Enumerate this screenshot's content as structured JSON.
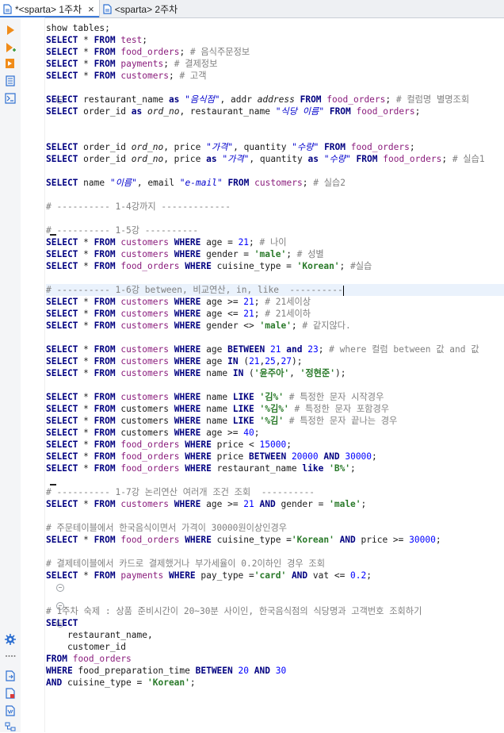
{
  "tabs": [
    {
      "label": "*<sparta> 1주차",
      "close": "×",
      "active": true
    },
    {
      "label": "<sparta> 2주차",
      "close": "",
      "active": false
    }
  ],
  "colors": {
    "keyword": "#000080",
    "table": "#8a1c7c",
    "string": "#0000cc",
    "literal": "#2a7a2a",
    "number": "#0000ff",
    "comment": "#808080"
  },
  "lines": [
    [
      [
        "t",
        "show tables;"
      ]
    ],
    [
      [
        "k",
        "SELECT"
      ],
      [
        "t",
        " * "
      ],
      [
        "k",
        "FROM"
      ],
      [
        "t",
        " "
      ],
      [
        "b",
        "test"
      ],
      [
        "t",
        ";"
      ]
    ],
    [
      [
        "k",
        "SELECT"
      ],
      [
        "t",
        " * "
      ],
      [
        "k",
        "FROM"
      ],
      [
        "t",
        " "
      ],
      [
        "b",
        "food_orders"
      ],
      [
        "t",
        "; "
      ],
      [
        "c",
        "# 음식주문정보"
      ]
    ],
    [
      [
        "k",
        "SELECT"
      ],
      [
        "t",
        " * "
      ],
      [
        "k",
        "FROM"
      ],
      [
        "t",
        " "
      ],
      [
        "b",
        "payments"
      ],
      [
        "t",
        "; "
      ],
      [
        "c",
        "# 결제정보"
      ]
    ],
    [
      [
        "k",
        "SELECT"
      ],
      [
        "t",
        " * "
      ],
      [
        "k",
        "FROM"
      ],
      [
        "t",
        " "
      ],
      [
        "b",
        "customers"
      ],
      [
        "t",
        "; "
      ],
      [
        "c",
        "# 고객"
      ]
    ],
    [],
    [
      [
        "k",
        "SELECT"
      ],
      [
        "t",
        " restaurant_name "
      ],
      [
        "k",
        "as"
      ],
      [
        "t",
        " "
      ],
      [
        "s",
        "\"음식점\""
      ],
      [
        "t",
        ", addr "
      ],
      [
        "i",
        "address"
      ],
      [
        "t",
        " "
      ],
      [
        "k",
        "FROM"
      ],
      [
        "t",
        " "
      ],
      [
        "b",
        "food_orders"
      ],
      [
        "t",
        "; "
      ],
      [
        "c",
        "# 컬럼명 별명조회"
      ]
    ],
    [
      [
        "k",
        "SELECT"
      ],
      [
        "t",
        " order_id "
      ],
      [
        "k",
        "as"
      ],
      [
        "t",
        " "
      ],
      [
        "i",
        "ord_no"
      ],
      [
        "t",
        ", restaurant_name "
      ],
      [
        "s",
        "\"식당 이름\""
      ],
      [
        "t",
        " "
      ],
      [
        "k",
        "FROM"
      ],
      [
        "t",
        " "
      ],
      [
        "b",
        "food_orders"
      ],
      [
        "t",
        ";"
      ]
    ],
    [],
    [],
    [
      [
        "k",
        "SELECT"
      ],
      [
        "t",
        " order_id "
      ],
      [
        "i",
        "ord_no"
      ],
      [
        "t",
        ", price "
      ],
      [
        "s",
        "\"가격\""
      ],
      [
        "t",
        ", quantity "
      ],
      [
        "s",
        "\"수량\""
      ],
      [
        "t",
        " "
      ],
      [
        "k",
        "FROM"
      ],
      [
        "t",
        " "
      ],
      [
        "b",
        "food_orders"
      ],
      [
        "t",
        ";"
      ]
    ],
    [
      [
        "k",
        "SELECT"
      ],
      [
        "t",
        " order_id "
      ],
      [
        "i",
        "ord_no"
      ],
      [
        "t",
        ", price "
      ],
      [
        "k",
        "as"
      ],
      [
        "t",
        " "
      ],
      [
        "s",
        "\"가격\""
      ],
      [
        "t",
        ", quantity "
      ],
      [
        "k",
        "as"
      ],
      [
        "t",
        " "
      ],
      [
        "s",
        "\"수량\""
      ],
      [
        "t",
        " "
      ],
      [
        "k",
        "FROM"
      ],
      [
        "t",
        " "
      ],
      [
        "b",
        "food_orders"
      ],
      [
        "t",
        "; "
      ],
      [
        "c",
        "# 실습1"
      ]
    ],
    [],
    [
      [
        "k",
        "SELECT"
      ],
      [
        "t",
        " name "
      ],
      [
        "s",
        "\"이름\""
      ],
      [
        "t",
        ", email "
      ],
      [
        "s",
        "\"e-mail\""
      ],
      [
        "t",
        " "
      ],
      [
        "k",
        "FROM"
      ],
      [
        "t",
        " "
      ],
      [
        "b",
        "customers"
      ],
      [
        "t",
        "; "
      ],
      [
        "c",
        "# 실습2"
      ]
    ],
    [],
    [
      [
        "c",
        "# ---------- 1-4강까지 -------------"
      ]
    ],
    [],
    [
      [
        "c",
        "# ---------- 1-5강 ----------"
      ]
    ],
    [
      [
        "k",
        "SELECT"
      ],
      [
        "t",
        " * "
      ],
      [
        "k",
        "FROM"
      ],
      [
        "t",
        " "
      ],
      [
        "b",
        "customers"
      ],
      [
        "t",
        " "
      ],
      [
        "k",
        "WHERE"
      ],
      [
        "t",
        " age = "
      ],
      [
        "n",
        "21"
      ],
      [
        "t",
        "; "
      ],
      [
        "c",
        "# 나이"
      ]
    ],
    [
      [
        "k",
        "SELECT"
      ],
      [
        "t",
        " * "
      ],
      [
        "k",
        "FROM"
      ],
      [
        "t",
        " "
      ],
      [
        "b",
        "customers"
      ],
      [
        "t",
        " "
      ],
      [
        "k",
        "WHERE"
      ],
      [
        "t",
        " gender = "
      ],
      [
        "q",
        "'male'"
      ],
      [
        "t",
        "; "
      ],
      [
        "c",
        "# 성별"
      ]
    ],
    [
      [
        "k",
        "SELECT"
      ],
      [
        "t",
        " * "
      ],
      [
        "k",
        "FROM"
      ],
      [
        "t",
        " "
      ],
      [
        "b",
        "food_orders"
      ],
      [
        "t",
        " "
      ],
      [
        "k",
        "WHERE"
      ],
      [
        "t",
        " cuisine_type = "
      ],
      [
        "q",
        "'Korean'"
      ],
      [
        "t",
        "; "
      ],
      [
        "c",
        "#실습"
      ]
    ],
    [],
    [
      [
        "c",
        "# ---------- 1-6강 between, 비교연산, in, like  ----------"
      ],
      [
        "x",
        ""
      ]
    ],
    [
      [
        "k",
        "SELECT"
      ],
      [
        "t",
        " * "
      ],
      [
        "k",
        "FROM"
      ],
      [
        "t",
        " "
      ],
      [
        "b",
        "customers"
      ],
      [
        "t",
        " "
      ],
      [
        "k",
        "WHERE"
      ],
      [
        "t",
        " age >= "
      ],
      [
        "n",
        "21"
      ],
      [
        "t",
        "; "
      ],
      [
        "c",
        "# 21세이상"
      ]
    ],
    [
      [
        "k",
        "SELECT"
      ],
      [
        "t",
        " * "
      ],
      [
        "k",
        "FROM"
      ],
      [
        "t",
        " "
      ],
      [
        "b",
        "customers"
      ],
      [
        "t",
        " "
      ],
      [
        "k",
        "WHERE"
      ],
      [
        "t",
        " age <= "
      ],
      [
        "n",
        "21"
      ],
      [
        "t",
        "; "
      ],
      [
        "c",
        "# 21세이하"
      ]
    ],
    [
      [
        "k",
        "SELECT"
      ],
      [
        "t",
        " * "
      ],
      [
        "k",
        "FROM"
      ],
      [
        "t",
        " "
      ],
      [
        "b",
        "customers"
      ],
      [
        "t",
        " "
      ],
      [
        "k",
        "WHERE"
      ],
      [
        "t",
        " gender <> "
      ],
      [
        "q",
        "'male'"
      ],
      [
        "t",
        "; "
      ],
      [
        "c",
        "# 같지않다."
      ]
    ],
    [],
    [
      [
        "k",
        "SELECT"
      ],
      [
        "t",
        " * "
      ],
      [
        "k",
        "FROM"
      ],
      [
        "t",
        " "
      ],
      [
        "b",
        "customers"
      ],
      [
        "t",
        " "
      ],
      [
        "k",
        "WHERE"
      ],
      [
        "t",
        " age "
      ],
      [
        "k",
        "BETWEEN"
      ],
      [
        "t",
        " "
      ],
      [
        "n",
        "21"
      ],
      [
        "t",
        " "
      ],
      [
        "k",
        "and"
      ],
      [
        "t",
        " "
      ],
      [
        "n",
        "23"
      ],
      [
        "t",
        "; "
      ],
      [
        "c",
        "# where 컬럼 between 값 and 값"
      ]
    ],
    [
      [
        "k",
        "SELECT"
      ],
      [
        "t",
        " * "
      ],
      [
        "k",
        "FROM"
      ],
      [
        "t",
        " "
      ],
      [
        "b",
        "customers"
      ],
      [
        "t",
        " "
      ],
      [
        "k",
        "WHERE"
      ],
      [
        "t",
        " age "
      ],
      [
        "k",
        "IN"
      ],
      [
        "t",
        " ("
      ],
      [
        "n",
        "21"
      ],
      [
        "t",
        ","
      ],
      [
        "n",
        "25"
      ],
      [
        "t",
        ","
      ],
      [
        "n",
        "27"
      ],
      [
        "t",
        ");"
      ]
    ],
    [
      [
        "k",
        "SELECT"
      ],
      [
        "t",
        " * "
      ],
      [
        "k",
        "FROM"
      ],
      [
        "t",
        " "
      ],
      [
        "b",
        "customers"
      ],
      [
        "t",
        " "
      ],
      [
        "k",
        "WHERE"
      ],
      [
        "t",
        " name "
      ],
      [
        "k",
        "IN"
      ],
      [
        "t",
        " ("
      ],
      [
        "q",
        "'윤주아'"
      ],
      [
        "t",
        ", "
      ],
      [
        "q",
        "'정현준'"
      ],
      [
        "t",
        ");"
      ]
    ],
    [],
    [
      [
        "k",
        "SELECT"
      ],
      [
        "t",
        " * "
      ],
      [
        "k",
        "FROM"
      ],
      [
        "t",
        " "
      ],
      [
        "b",
        "customers"
      ],
      [
        "t",
        " "
      ],
      [
        "k",
        "WHERE"
      ],
      [
        "t",
        " name "
      ],
      [
        "k",
        "LIKE"
      ],
      [
        "t",
        " "
      ],
      [
        "q",
        "'김%'"
      ],
      [
        "t",
        " "
      ],
      [
        "c",
        "# 특정한 문자 시작경우"
      ]
    ],
    [
      [
        "k",
        "SELECT"
      ],
      [
        "t",
        " * "
      ],
      [
        "k",
        "FROM"
      ],
      [
        "t",
        " customers "
      ],
      [
        "k",
        "WHERE"
      ],
      [
        "t",
        " name "
      ],
      [
        "k",
        "LIKE"
      ],
      [
        "t",
        " "
      ],
      [
        "q",
        "'%김%'"
      ],
      [
        "t",
        " "
      ],
      [
        "c",
        "# 특정한 문자 포함경우"
      ]
    ],
    [
      [
        "k",
        "SELECT"
      ],
      [
        "t",
        " * "
      ],
      [
        "k",
        "FROM"
      ],
      [
        "t",
        " customers "
      ],
      [
        "k",
        "WHERE"
      ],
      [
        "t",
        " name "
      ],
      [
        "k",
        "LIKE"
      ],
      [
        "t",
        " "
      ],
      [
        "q",
        "'%김'"
      ],
      [
        "t",
        " "
      ],
      [
        "c",
        "# 특정한 문자 끝나는 경우"
      ]
    ],
    [
      [
        "k",
        "SELECT"
      ],
      [
        "t",
        " * "
      ],
      [
        "k",
        "FROM"
      ],
      [
        "t",
        " customers "
      ],
      [
        "k",
        "WHERE"
      ],
      [
        "t",
        " age >= "
      ],
      [
        "n",
        "40"
      ],
      [
        "t",
        ";"
      ]
    ],
    [
      [
        "k",
        "SELECT"
      ],
      [
        "t",
        " * "
      ],
      [
        "k",
        "FROM"
      ],
      [
        "t",
        " "
      ],
      [
        "b",
        "food_orders"
      ],
      [
        "t",
        " "
      ],
      [
        "k",
        "WHERE"
      ],
      [
        "t",
        " price < "
      ],
      [
        "n",
        "15000"
      ],
      [
        "t",
        ";"
      ]
    ],
    [
      [
        "k",
        "SELECT"
      ],
      [
        "t",
        " * "
      ],
      [
        "k",
        "FROM"
      ],
      [
        "t",
        " "
      ],
      [
        "b",
        "food_orders"
      ],
      [
        "t",
        " "
      ],
      [
        "k",
        "WHERE"
      ],
      [
        "t",
        " price "
      ],
      [
        "k",
        "BETWEEN"
      ],
      [
        "t",
        " "
      ],
      [
        "n",
        "20000"
      ],
      [
        "t",
        " "
      ],
      [
        "k",
        "AND"
      ],
      [
        "t",
        " "
      ],
      [
        "n",
        "30000"
      ],
      [
        "t",
        ";"
      ]
    ],
    [
      [
        "k",
        "SELECT"
      ],
      [
        "t",
        " * "
      ],
      [
        "k",
        "FROM"
      ],
      [
        "t",
        " "
      ],
      [
        "b",
        "food_orders"
      ],
      [
        "t",
        " "
      ],
      [
        "k",
        "WHERE"
      ],
      [
        "t",
        " restaurant_name "
      ],
      [
        "k",
        "like"
      ],
      [
        "t",
        " "
      ],
      [
        "q",
        "'B%'"
      ],
      [
        "t",
        ";"
      ]
    ],
    [],
    [
      [
        "c",
        "# ---------- 1-7강 논리연산 여러개 조건 조회  ----------"
      ]
    ],
    [
      [
        "k",
        "SELECT"
      ],
      [
        "t",
        " * "
      ],
      [
        "k",
        "FROM"
      ],
      [
        "t",
        " "
      ],
      [
        "b",
        "customers"
      ],
      [
        "t",
        " "
      ],
      [
        "k",
        "WHERE"
      ],
      [
        "t",
        " age >= "
      ],
      [
        "n",
        "21"
      ],
      [
        "t",
        " "
      ],
      [
        "k",
        "AND"
      ],
      [
        "t",
        " gender = "
      ],
      [
        "q",
        "'male'"
      ],
      [
        "t",
        ";"
      ]
    ],
    [],
    [
      [
        "c",
        "# 주문테이블에서 한국음식이면서 가격이 30000원이상인경우"
      ]
    ],
    [
      [
        "k",
        "SELECT"
      ],
      [
        "t",
        " * "
      ],
      [
        "k",
        "FROM"
      ],
      [
        "t",
        " "
      ],
      [
        "b",
        "food_orders"
      ],
      [
        "t",
        " "
      ],
      [
        "k",
        "WHERE"
      ],
      [
        "t",
        " cuisine_type ="
      ],
      [
        "q",
        "'Korean'"
      ],
      [
        "t",
        " "
      ],
      [
        "k",
        "AND"
      ],
      [
        "t",
        " price >= "
      ],
      [
        "n",
        "30000"
      ],
      [
        "t",
        ";"
      ]
    ],
    [],
    [
      [
        "c",
        "# 결제테이블에서 카드로 결제했거나 부가세율이 0.2이하인 경우 조회"
      ]
    ],
    [
      [
        "k",
        "SELECT"
      ],
      [
        "t",
        " * "
      ],
      [
        "k",
        "FROM"
      ],
      [
        "t",
        " "
      ],
      [
        "b",
        "payments"
      ],
      [
        "t",
        " "
      ],
      [
        "k",
        "WHERE"
      ],
      [
        "t",
        " pay_type ="
      ],
      [
        "q",
        "'card'"
      ],
      [
        "t",
        " "
      ],
      [
        "k",
        "AND"
      ],
      [
        "t",
        " vat <= "
      ],
      [
        "n",
        "0.2"
      ],
      [
        "t",
        ";"
      ]
    ],
    [],
    [],
    [
      [
        "c",
        "# 1주차 숙제 : 상품 준비시간이 20~30분 사이인, 한국음식점의 식당명과 고객번호 조회하기"
      ]
    ],
    [
      [
        "k",
        "SELECT"
      ]
    ],
    [
      [
        "t",
        "    restaurant_name,"
      ]
    ],
    [
      [
        "t",
        "    customer_id"
      ]
    ],
    [
      [
        "k",
        "FROM"
      ],
      [
        "t",
        " "
      ],
      [
        "b",
        "food_orders"
      ]
    ],
    [
      [
        "k",
        "WHERE"
      ],
      [
        "t",
        " food_preparation_time "
      ],
      [
        "k",
        "BETWEEN"
      ],
      [
        "t",
        " "
      ],
      [
        "n",
        "20"
      ],
      [
        "t",
        " "
      ],
      [
        "k",
        "AND"
      ],
      [
        "t",
        " "
      ],
      [
        "n",
        "30"
      ]
    ],
    [
      [
        "k",
        "AND"
      ],
      [
        "t",
        " cuisine_type = "
      ],
      [
        "q",
        "'Korean'"
      ],
      [
        "t",
        ";"
      ]
    ]
  ]
}
